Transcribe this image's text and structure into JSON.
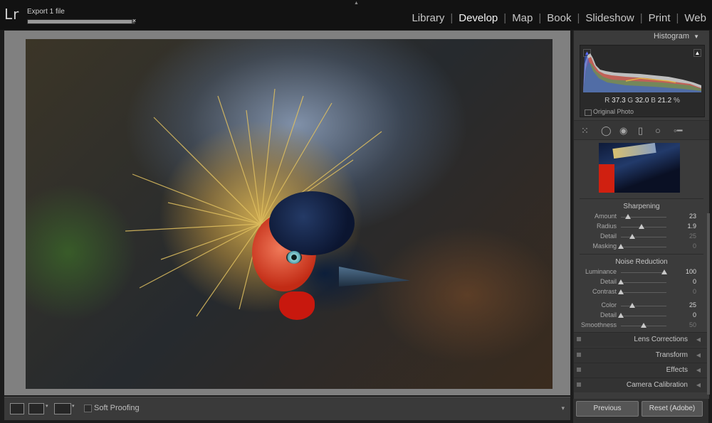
{
  "app": {
    "logo": "Lr"
  },
  "export": {
    "title": "Export 1 file",
    "close": "×",
    "progress": 0.97
  },
  "modules": [
    {
      "label": "Library",
      "active": false
    },
    {
      "label": "Develop",
      "active": true
    },
    {
      "label": "Map",
      "active": false
    },
    {
      "label": "Book",
      "active": false
    },
    {
      "label": "Slideshow",
      "active": false
    },
    {
      "label": "Print",
      "active": false
    },
    {
      "label": "Web",
      "active": false
    }
  ],
  "histogram": {
    "title": "Histogram",
    "rgb": {
      "r_label": "R",
      "r": "37.3",
      "g_label": "G",
      "g": "32.0",
      "b_label": "B",
      "b": "21.2",
      "unit": "%"
    },
    "original_photo_label": "Original Photo"
  },
  "sharpening": {
    "title": "Sharpening",
    "sliders": [
      {
        "label": "Amount",
        "value": "23",
        "fraction": 0.15,
        "dim": false
      },
      {
        "label": "Radius",
        "value": "1.9",
        "fraction": 0.45,
        "dim": false
      },
      {
        "label": "Detail",
        "value": "25",
        "fraction": 0.25,
        "dim": true
      },
      {
        "label": "Masking",
        "value": "0",
        "fraction": 0.0,
        "dim": true
      }
    ]
  },
  "noise_reduction": {
    "title": "Noise Reduction",
    "sliders": [
      {
        "label": "Luminance",
        "value": "100",
        "fraction": 0.95,
        "dim": false
      },
      {
        "label": "Detail",
        "value": "0",
        "fraction": 0.0,
        "dim": false
      },
      {
        "label": "Contrast",
        "value": "0",
        "fraction": 0.0,
        "dim": true
      },
      {
        "label": "Color",
        "value": "25",
        "fraction": 0.25,
        "dim": false
      },
      {
        "label": "Detail",
        "value": "0",
        "fraction": 0.0,
        "dim": false
      },
      {
        "label": "Smoothness",
        "value": "50",
        "fraction": 0.5,
        "dim": true
      }
    ]
  },
  "panels": [
    {
      "label": "Lens Corrections"
    },
    {
      "label": "Transform"
    },
    {
      "label": "Effects"
    },
    {
      "label": "Camera Calibration"
    }
  ],
  "toolbar": {
    "soft_proofing_label": "Soft Proofing"
  },
  "buttons": {
    "previous": "Previous",
    "reset": "Reset (Adobe)"
  }
}
